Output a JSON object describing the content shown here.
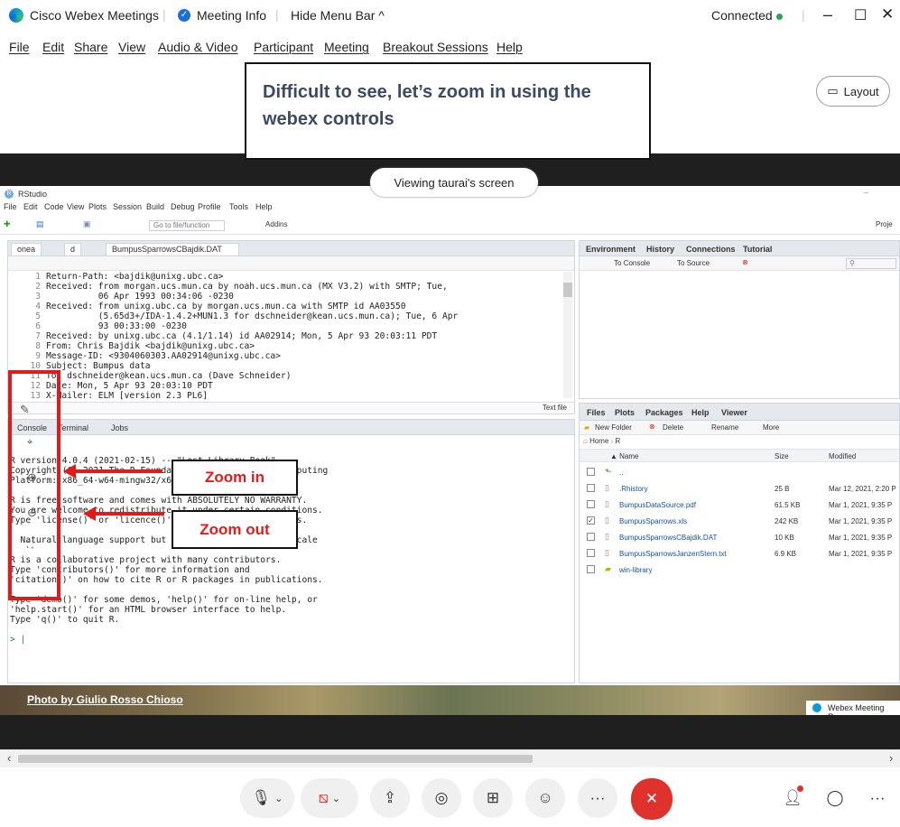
{
  "titlebar": {
    "app_name": "Cisco Webex Meetings",
    "meeting_info": "Meeting Info",
    "hide_menu": "Hide Menu Bar ^",
    "status": "Connected",
    "status_dot_color": "#2ea44f"
  },
  "menubar": [
    "File",
    "Edit",
    "Share",
    "View",
    "Audio & Video",
    "Participant",
    "Meeting",
    "Breakout Sessions",
    "Help"
  ],
  "annotation": {
    "text": "Difficult to see, let’s zoom in using the webex controls"
  },
  "layout_button": "Layout",
  "viewing_pill": "Viewing taurai's screen",
  "rstudio": {
    "title": "RStudio",
    "menu": [
      "File",
      "Edit",
      "Code",
      "View",
      "Plots",
      "Session",
      "Build",
      "Debug",
      "Profile",
      "Tools",
      "Help"
    ],
    "goto_placeholder": "Go to file/function",
    "addins": "Addins",
    "project": "Proje",
    "editor_tabs": [
      "onea",
      "d",
      "BumpusSparrowsCBajdik.DAT"
    ],
    "editor_lines": [
      {
        "n": "1",
        "t": "Return-Path: <bajdik@unixg.ubc.ca>"
      },
      {
        "n": "2",
        "t": "Received: from morgan.ucs.mun.ca by noah.ucs.mun.ca (MX V3.2) with SMTP; Tue,"
      },
      {
        "n": "3",
        "t": "          06 Apr 1993 00:34:06 -0230"
      },
      {
        "n": "4",
        "t": "Received: from unixg.ubc.ca by morgan.ucs.mun.ca with SMTP id AA03550"
      },
      {
        "n": "5",
        "t": "          (5.65d3+/IDA-1.4.2+MUN1.3 for dschneider@kean.ucs.mun.ca); Tue, 6 Apr"
      },
      {
        "n": "6",
        "t": "          93 00:33:00 -0230"
      },
      {
        "n": "7",
        "t": "Received: by unixg.ubc.ca (4.1/1.14) id AA02914; Mon, 5 Apr 93 20:03:11 PDT"
      },
      {
        "n": "8",
        "t": "From: Chris Bajdik <bajdik@unixg.ubc.ca>"
      },
      {
        "n": "9",
        "t": "Message-ID: <9304060303.AA02914@unixg.ubc.ca>"
      },
      {
        "n": "10",
        "t": "Subject: Bumpus data"
      },
      {
        "n": "11",
        "t": "To: dschneider@kean.ucs.mun.ca (Dave Schneider)"
      },
      {
        "n": "12",
        "t": "Date: Mon, 5 Apr 93 20:03:10 PDT"
      },
      {
        "n": "13",
        "t": "X-Mailer: ELM [version 2.3 PL6]"
      }
    ],
    "text_file": "Text file",
    "console_tabs": [
      "Console",
      "Terminal",
      "Jobs"
    ],
    "console_lines": [
      "R version 4.0.4 (2021-02-15) -- \"Lost Library Book\"",
      "Copyright (C) 2021 The R Foundation for Statistical Computing",
      "Platform: x86_64-w64-mingw32/x64 (64-bit)",
      "",
      "R is free software and comes with ABSOLUTELY NO WARRANTY.",
      "You are welcome to redistribute it under certain conditions.",
      "Type 'license()' or 'licence()' for distribution details.",
      "",
      "  Natural language support but running in an English locale",
      "",
      "R is a collaborative project with many contributors.",
      "Type 'contributors()' for more information and",
      "'citation()' on how to cite R or R packages in publications.",
      "",
      "Type 'demo()' for some demos, 'help()' for on-line help, or",
      "'help.start()' for an HTML browser interface to help.",
      "Type 'q()' to quit R.",
      "",
      "> |"
    ],
    "env_tabs": [
      "Environment",
      "History",
      "Connections",
      "Tutorial"
    ],
    "env_toolbar": [
      "To Console",
      "To Source"
    ],
    "files_tabs": [
      "Files",
      "Plots",
      "Packages",
      "Help",
      "Viewer"
    ],
    "files_toolbar": [
      "New Folder",
      "Delete",
      "Rename",
      "More"
    ],
    "breadcrumb": [
      "Home",
      "R"
    ],
    "files_header": {
      "name": "▲ Name",
      "size": "Size",
      "modified": "Modified"
    },
    "files": [
      {
        "name": "..",
        "size": "",
        "modified": "",
        "checked": false
      },
      {
        "name": ".Rhistory",
        "size": "25 B",
        "modified": "Mar 12, 2021, 2:20 P",
        "checked": false
      },
      {
        "name": "BumpusDataSource.pdf",
        "size": "61.5 KB",
        "modified": "Mar 1, 2021, 9:35 P",
        "checked": false
      },
      {
        "name": "BumpusSparrows.xls",
        "size": "242 KB",
        "modified": "Mar 1, 2021, 9:35 P",
        "checked": true
      },
      {
        "name": "BumpusSparrowsCBajdik.DAT",
        "size": "10 KB",
        "modified": "Mar 1, 2021, 9:35 P",
        "checked": false
      },
      {
        "name": "BumpusSparrowsJanzenStern.txt",
        "size": "6.9 KB",
        "modified": "Mar 1, 2021, 9:35 P",
        "checked": false
      },
      {
        "name": "win-library",
        "size": "",
        "modified": "",
        "checked": false
      }
    ]
  },
  "zoom_in_label": "Zoom in",
  "zoom_out_label": "Zoom out",
  "photo_credit": "Photo by Giulio Rosso Chioso",
  "webex_meeting_tag": "Webex Meeting Ren",
  "controls": {
    "more1": "···",
    "more2": "···"
  }
}
